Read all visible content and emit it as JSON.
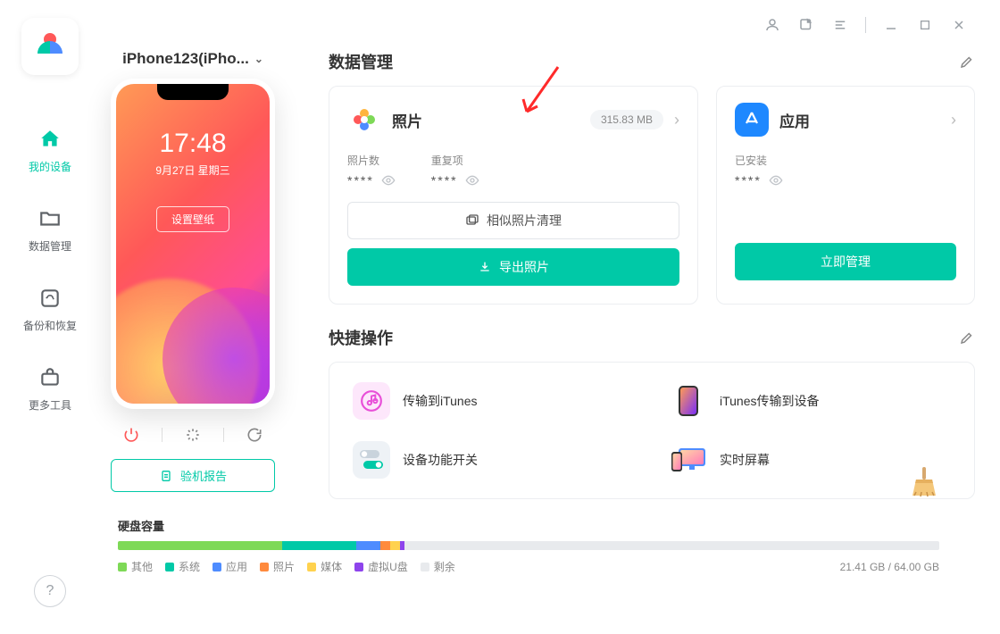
{
  "sidebar": {
    "items": [
      {
        "label": "我的设备"
      },
      {
        "label": "数据管理"
      },
      {
        "label": "备份和恢复"
      },
      {
        "label": "更多工具"
      }
    ]
  },
  "header": {
    "device_name": "iPhone123(iPho..."
  },
  "phone": {
    "time": "17:48",
    "date": "9月27日 星期三",
    "wallpaper_btn": "设置壁纸"
  },
  "device": {
    "report_btn": "验机报告"
  },
  "sections": {
    "data_mgmt": "数据管理",
    "quick_ops": "快捷操作"
  },
  "photos_card": {
    "title": "照片",
    "size": "315.83 MB",
    "count_label": "照片数",
    "dup_label": "重复项",
    "count_value": "****",
    "dup_value": "****",
    "clean_btn": "相似照片清理",
    "export_btn": "导出照片"
  },
  "apps_card": {
    "title": "应用",
    "installed_label": "已安装",
    "installed_value": "****",
    "manage_btn": "立即管理"
  },
  "quick": {
    "items": [
      {
        "label": "传输到iTunes"
      },
      {
        "label": "iTunes传输到设备"
      },
      {
        "label": "设备功能开关"
      },
      {
        "label": "实时屏幕"
      }
    ]
  },
  "disk": {
    "title": "硬盘容量",
    "total": "21.41 GB / 64.00 GB",
    "legend": [
      {
        "label": "其他",
        "color": "#7ed957"
      },
      {
        "label": "系统",
        "color": "#00c9a7"
      },
      {
        "label": "应用",
        "color": "#4e8cff"
      },
      {
        "label": "照片",
        "color": "#ff8a3d"
      },
      {
        "label": "媒体",
        "color": "#ffd24e"
      },
      {
        "label": "虚拟U盘",
        "color": "#8e44ec"
      },
      {
        "label": "剩余",
        "color": "#e8eaed"
      }
    ],
    "segments": [
      {
        "color": "#7ed957",
        "pct": 20
      },
      {
        "color": "#00c9a7",
        "pct": 9
      },
      {
        "color": "#4e8cff",
        "pct": 3
      },
      {
        "color": "#ff8a3d",
        "pct": 1.2
      },
      {
        "color": "#ffd24e",
        "pct": 1.2
      },
      {
        "color": "#8e44ec",
        "pct": 0.5
      },
      {
        "color": "#e8eaed",
        "pct": 65.1
      }
    ]
  }
}
